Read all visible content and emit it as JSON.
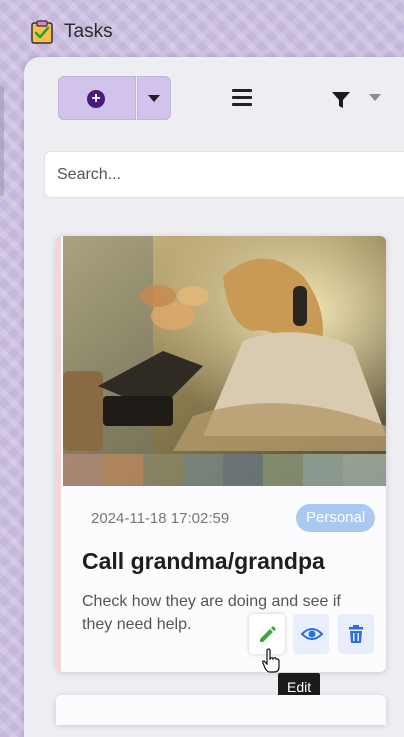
{
  "window": {
    "title": "Tasks",
    "icon": "clipboard-check-icon"
  },
  "toolbar": {
    "add_icon": "plus-circle-icon",
    "dropdown_icon": "caret-down-icon",
    "list_view_icon": "list-icon",
    "filter_icon": "filter-icon"
  },
  "search": {
    "placeholder": "Search...",
    "value": ""
  },
  "tasks": [
    {
      "date": "2024-11-18 17:02:59",
      "category": "Personal",
      "title": "Call grandma/grandpa",
      "description": "Check how they are doing and see if they need help.",
      "image": "watercolor-child-on-phone",
      "actions": {
        "edit": "pencil-icon",
        "view": "eye-icon",
        "delete": "trash-icon"
      }
    }
  ],
  "tooltip": {
    "text": "Edit"
  },
  "colors": {
    "accent": "#d1c3ea",
    "badge": "#a9c8f2",
    "edit_icon": "#3fa53a",
    "view_icon": "#2f6fdb",
    "delete_icon": "#2f6fdb"
  }
}
